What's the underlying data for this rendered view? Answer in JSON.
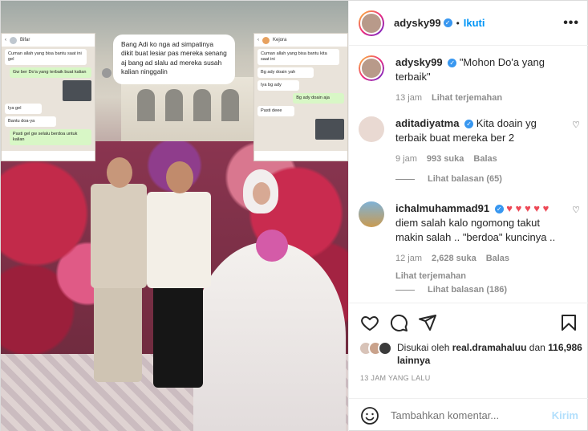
{
  "post": {
    "author": "adysky99",
    "follow_label": "Ikuti",
    "dot": "•",
    "more_label": "•••"
  },
  "caption": {
    "user": "adysky99",
    "text": "\"Mohon Do'a yang terbaik\"",
    "time": "13 jam",
    "translate": "Lihat terjemahan"
  },
  "comments": [
    {
      "user": "aditadiyatma",
      "text": "Kita doain yg terbaik buat mereka ber 2",
      "time": "9 jam",
      "likes": "993 suka",
      "reply": "Balas",
      "view_replies": "Lihat balasan (65)"
    },
    {
      "user": "ichalmuhammad91",
      "hearts": "♥ ♥ ♥ ♥ ♥",
      "text": "diem salah kalo ngomong takut makin salah .. \"berdoa\" kuncinya ..",
      "time": "12 jam",
      "likes": "2,628 suka",
      "reply": "Balas",
      "translate": "Lihat terjemahan",
      "view_replies": "Lihat balasan (186)"
    }
  ],
  "likes": {
    "prefix": "Disukai oleh",
    "user": "real.dramahaluu",
    "mid": "dan",
    "count": "116,986 lainnya"
  },
  "time_ago": "13 JAM YANG LALU",
  "compose": {
    "placeholder": "Tambahkan komentar...",
    "post_label": "Kirim"
  },
  "media": {
    "note_text": "Bang Adi ko nga ad simpatinya dikit buat lesiar pas mereka senang aj bang ad slalu ad mereka susah kalian ninggalin",
    "chat_left": {
      "name": "Bifar",
      "messages": [
        "Cuman allah yang bisa bantu saat ini gel",
        "Gw ber Do'a yang terbaik buat kalian",
        "Iya gel",
        "Bantu doa-ya",
        "Pasti gel gw selalu berdoa untuk kalian"
      ]
    },
    "chat_right": {
      "name": "Kejora",
      "messages": [
        "Cuman allah yang bisa bantu kita saat ini",
        "Bg ady doain yah",
        "Iya bg ady",
        "Bg ady doain aja",
        "Pasti deee"
      ]
    }
  },
  "colors": {
    "accent": "#0095f6",
    "verified": "#3897f0",
    "heart_red": "#ed4956",
    "muted": "#8e8e8e"
  },
  "icons": [
    "verified-badge-icon",
    "more-options-icon",
    "heart-icon",
    "comment-icon",
    "share-icon",
    "save-icon",
    "emoji-icon"
  ]
}
